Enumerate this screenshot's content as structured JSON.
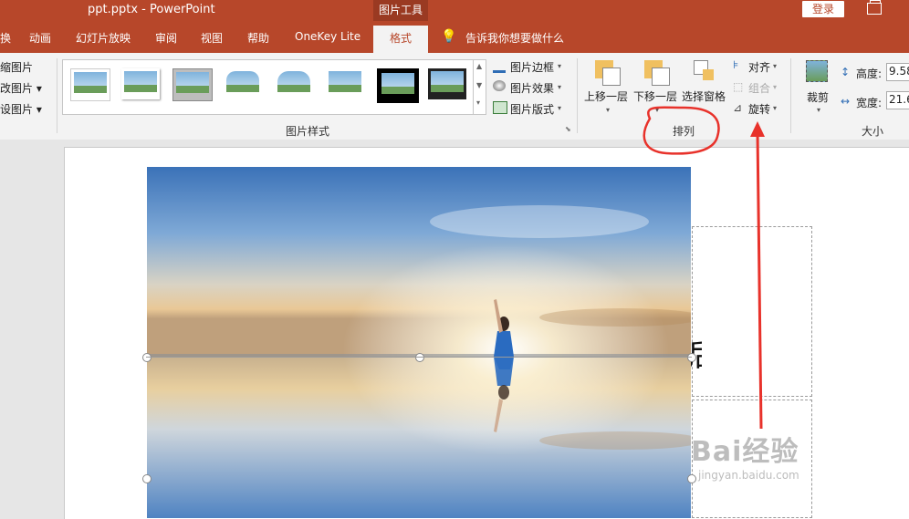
{
  "window": {
    "title": "ppt.pptx  -  PowerPoint",
    "context_tab_group": "图片工具",
    "login_label": "登录"
  },
  "tabs": [
    "换",
    "动画",
    "幻灯片放映",
    "审阅",
    "视图",
    "帮助",
    "OneKey Lite"
  ],
  "active_tab": "格式",
  "tell_me": "告诉我你想要做什么",
  "ribbon": {
    "adjust_partial": [
      "缩图片",
      "改图片 ▾",
      "设图片 ▾"
    ],
    "picture_styles": {
      "label": "图片样式",
      "border": "图片边框",
      "effects": "图片效果",
      "layout": "图片版式"
    },
    "arrange": {
      "label": "排列",
      "bring_forward": "上移一层",
      "send_backward": "下移一层",
      "selection_pane": "选择窗格",
      "align": "对齐",
      "group": "组合",
      "rotate": "旋转"
    },
    "size": {
      "label": "大小",
      "crop": "裁剪",
      "height_label": "高度:",
      "height_value": "9.58",
      "width_label": "宽度:",
      "width_value": "21.6"
    }
  },
  "colors": {
    "brand": "#b7472a",
    "annotation": "#e8322b"
  },
  "slide": {
    "text_fragment": "后",
    "watermark_brand": "Bai经验",
    "watermark_url": "jingyan.baidu.com"
  }
}
